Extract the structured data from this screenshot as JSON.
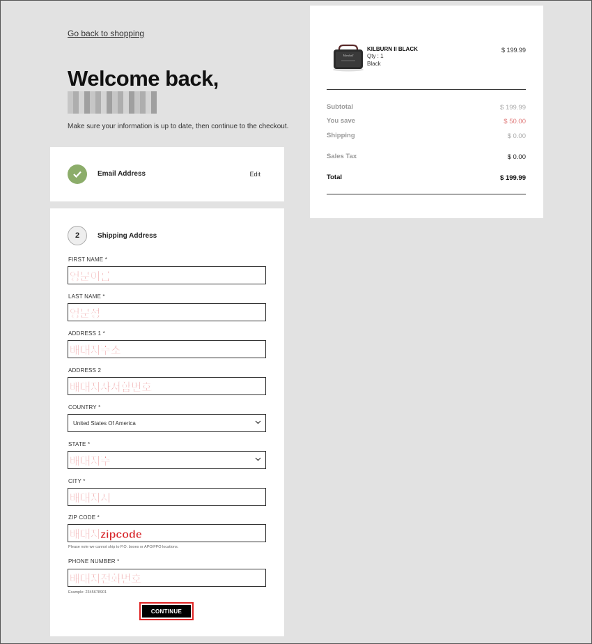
{
  "nav": {
    "back_label": "Go back to shopping"
  },
  "header": {
    "welcome": "Welcome back,",
    "subtitle": "Make sure your information is up to date, then continue to the checkout."
  },
  "email_step": {
    "label": "Email Address",
    "edit": "Edit"
  },
  "shipping_step": {
    "number": "2",
    "label": "Shipping Address",
    "fields": {
      "first_name": {
        "label": "FIRST NAME *",
        "value": "영문이름"
      },
      "last_name": {
        "label": "LAST NAME *",
        "value": "영문성"
      },
      "address1": {
        "label": "ADDRESS 1 *",
        "value": "배대지주소"
      },
      "address2": {
        "label": "ADDRESS 2",
        "value": "배대지사서함번호"
      },
      "country": {
        "label": "COUNTRY *",
        "value": "United States Of America"
      },
      "state": {
        "label": "STATE *",
        "value": "배대지주"
      },
      "city": {
        "label": "CITY *",
        "value": "배대지시"
      },
      "zip": {
        "label": "ZIP CODE *",
        "value": "배대지zipcode",
        "note": "Please note we cannot ship to P.O. boxes or APO/FPO locations."
      },
      "phone": {
        "label": "PHONE NUMBER *",
        "value": "배대지전화번호",
        "note": "Example: 2345678901"
      }
    },
    "continue_label": "CONTINUE"
  },
  "summary": {
    "product": {
      "name": "KILBURN II BLACK",
      "qty": "Qty : 1",
      "color": "Black",
      "price": "$ 199.99",
      "image_icon": "speaker-icon"
    },
    "rows": {
      "subtotal": {
        "label": "Subtotal",
        "value": "$ 199.99"
      },
      "you_save": {
        "label": "You save",
        "value": "$ 50.00"
      },
      "shipping": {
        "label": "Shipping",
        "value": "$ 0.00"
      },
      "sales_tax": {
        "label": "Sales Tax",
        "value": "$ 0.00"
      },
      "total": {
        "label": "Total",
        "value": "$ 199.99"
      }
    }
  },
  "colors": {
    "check_green": "#8cad6a",
    "annotation_red": "#d7262a",
    "button_black": "#000000",
    "you_save_red": "#e07a7a"
  }
}
